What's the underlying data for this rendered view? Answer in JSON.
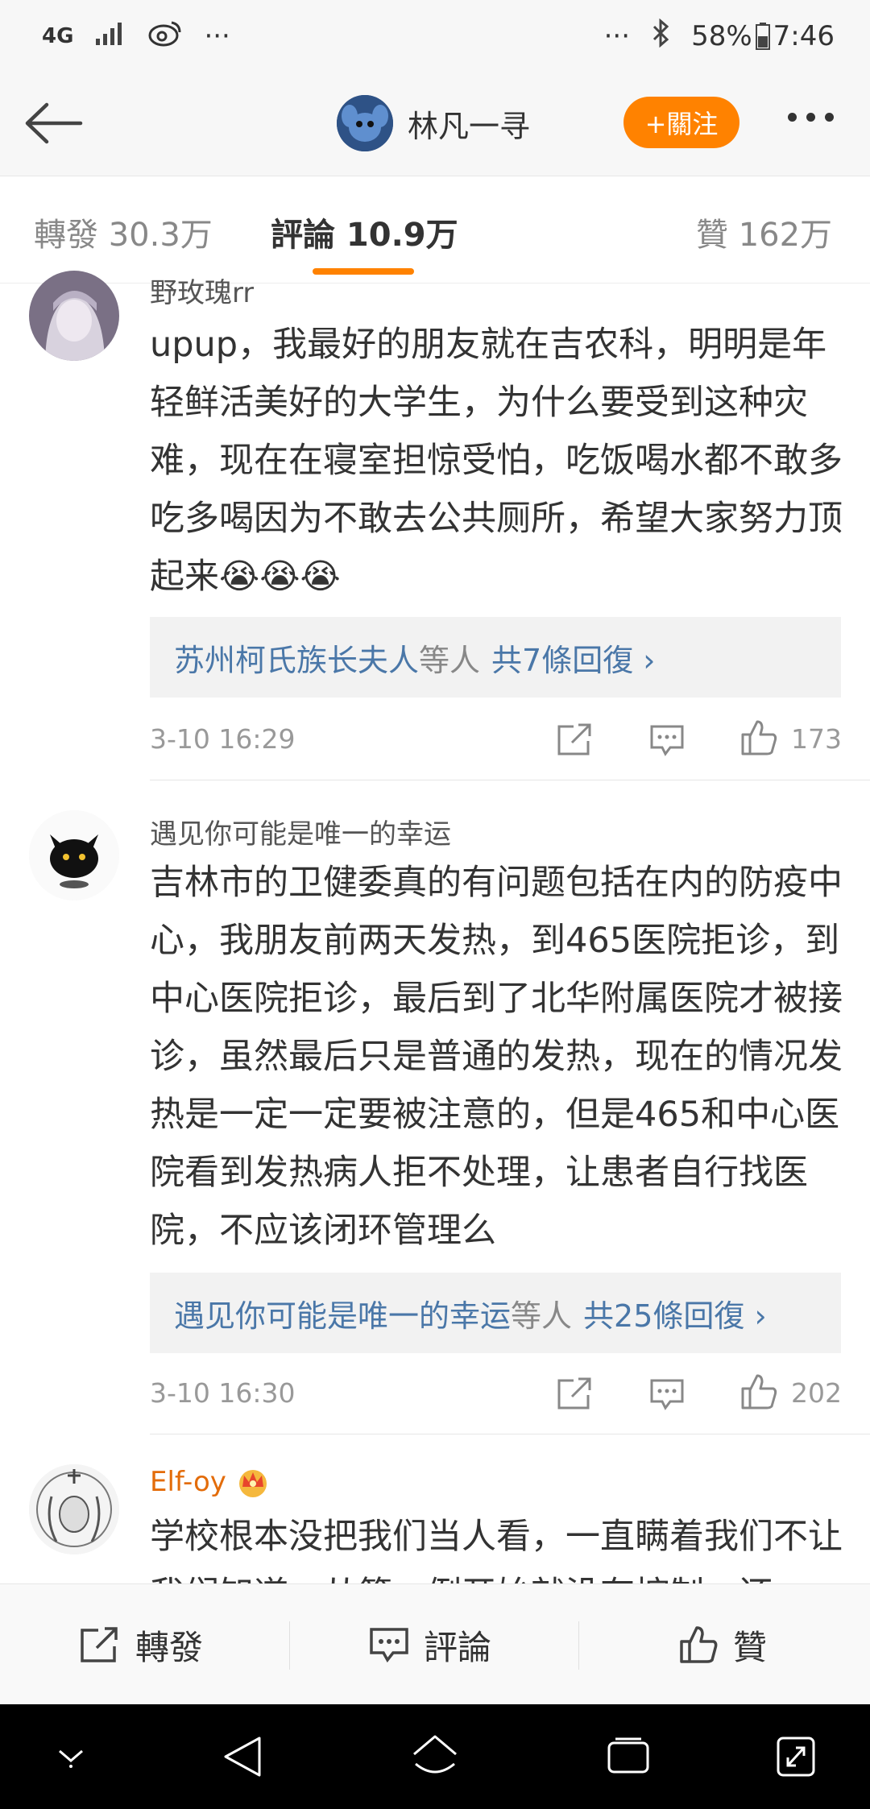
{
  "status_bar": {
    "network": "4G",
    "battery": "58%",
    "time": "7:46",
    "dots": "···"
  },
  "header": {
    "title": "林凡一寻",
    "follow_label": "+關注"
  },
  "tabs": [
    {
      "label": "轉發 30.3万"
    },
    {
      "label": "評論 10.9万"
    },
    {
      "label": "贊 162万"
    }
  ],
  "comments": [
    {
      "username": "野玫瑰rr",
      "text": "upup，我最好的朋友就在吉农科，明明是年轻鲜活美好的大学生，为什么要受到这种灾难，现在在寝室担惊受怕，吃饭喝水都不敢多吃多喝因为不敢去公共厕所，希望大家努力顶起来😭😭😭",
      "reply_users": "苏州柯氏族长夫人",
      "reply_mid": "等人",
      "reply_count": "共7條回復 ›",
      "time": "3-10 16:29",
      "likes": "173"
    },
    {
      "username": "遇见你可能是唯一的幸运",
      "text": "吉林市的卫健委真的有问题包括在内的防疫中心，我朋友前两天发热，到465医院拒诊，到中心医院拒诊，最后到了北华附属医院才被接诊，虽然最后只是普通的发热，现在的情况发热是一定一定要被注意的，但是465和中心医院看到发热病人拒不处理，让患者自行找医院，不应该闭环管理么",
      "reply_users": "遇见你可能是唯一的幸运",
      "reply_mid": "等人",
      "reply_count": "共25條回復 ›",
      "time": "3-10 16:30",
      "likes": "202"
    },
    {
      "username": "Elf-oy",
      "text": "学校根本没把我们当人看，一直瞒着我们不让我们知道，从第一例开始就没有控制，还"
    }
  ],
  "bottom_bar": {
    "repost": "轉發",
    "comment": "評論",
    "like": "贊"
  },
  "colors": {
    "accent": "#ff8200",
    "link": "#4a77a8",
    "vip_name": "#e36c0a"
  }
}
